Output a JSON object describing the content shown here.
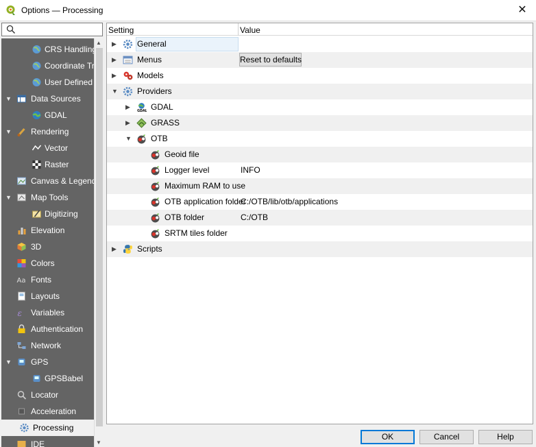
{
  "window": {
    "title": "Options — Processing",
    "close_symbol": "✕"
  },
  "search": {
    "placeholder": ""
  },
  "sidebar": {
    "items": [
      {
        "label": "CRS Handling",
        "icon": "globe-icon",
        "level": 1
      },
      {
        "label": "Coordinate Transforms",
        "icon": "globe-icon",
        "level": 1
      },
      {
        "label": "User Defined CRS",
        "icon": "globe-icon",
        "level": 1
      },
      {
        "label": "Data Sources",
        "icon": "table-icon",
        "level": 0,
        "expanded": true
      },
      {
        "label": "GDAL",
        "icon": "gdal-globe-icon",
        "level": 1
      },
      {
        "label": "Rendering",
        "icon": "brush-icon",
        "level": 0,
        "expanded": true
      },
      {
        "label": "Vector",
        "icon": "vector-icon",
        "level": 1
      },
      {
        "label": "Raster",
        "icon": "raster-icon",
        "level": 1
      },
      {
        "label": "Canvas & Legend",
        "icon": "canvas-icon",
        "level": 0
      },
      {
        "label": "Map Tools",
        "icon": "map-tools-icon",
        "level": 0,
        "expanded": true
      },
      {
        "label": "Digitizing",
        "icon": "digitizing-icon",
        "level": 1
      },
      {
        "label": "Elevation",
        "icon": "elevation-icon",
        "level": 0
      },
      {
        "label": "3D",
        "icon": "cube-icon",
        "level": 0
      },
      {
        "label": "Colors",
        "icon": "colors-icon",
        "level": 0
      },
      {
        "label": "Fonts",
        "icon": "fonts-icon",
        "level": 0
      },
      {
        "label": "Layouts",
        "icon": "layouts-icon",
        "level": 0
      },
      {
        "label": "Variables",
        "icon": "variables-icon",
        "level": 0
      },
      {
        "label": "Authentication",
        "icon": "lock-icon",
        "level": 0
      },
      {
        "label": "Network",
        "icon": "network-icon",
        "level": 0
      },
      {
        "label": "GPS",
        "icon": "gps-icon",
        "level": 0,
        "expanded": true
      },
      {
        "label": "GPSBabel",
        "icon": "gps-icon",
        "level": 1
      },
      {
        "label": "Locator",
        "icon": "search-icon",
        "level": 0
      },
      {
        "label": "Acceleration",
        "icon": "chip-icon",
        "level": 0
      },
      {
        "label": "Processing",
        "icon": "gear-icon",
        "level": 0,
        "selected": true
      },
      {
        "label": "IDE",
        "icon": "ide-icon",
        "level": 0
      }
    ]
  },
  "tree": {
    "header": {
      "setting": "Setting",
      "value": "Value"
    },
    "rows": [
      {
        "label": "General",
        "icon": "gear-icon",
        "level": 0,
        "toggle": "collapsed",
        "selected": true
      },
      {
        "label": "Menus",
        "icon": "menus-icon",
        "level": 0,
        "toggle": "collapsed",
        "button": "Reset to defaults"
      },
      {
        "label": "Models",
        "icon": "models-icon",
        "level": 0,
        "toggle": "collapsed"
      },
      {
        "label": "Providers",
        "icon": "gear-icon",
        "level": 0,
        "toggle": "expanded"
      },
      {
        "label": "GDAL",
        "icon": "gdal-icon",
        "level": 1,
        "toggle": "collapsed"
      },
      {
        "label": "GRASS",
        "icon": "grass-icon",
        "level": 1,
        "toggle": "collapsed"
      },
      {
        "label": "OTB",
        "icon": "otb-icon",
        "level": 1,
        "toggle": "expanded"
      },
      {
        "label": "Geoid file",
        "icon": "otb-icon",
        "level": 2,
        "value": ""
      },
      {
        "label": "Logger level",
        "icon": "otb-icon",
        "level": 2,
        "value": "INFO"
      },
      {
        "label": "Maximum RAM to use",
        "icon": "otb-icon",
        "level": 2,
        "value": ""
      },
      {
        "label": "OTB application folder",
        "icon": "otb-icon",
        "level": 2,
        "value": "C:/OTB/lib/otb/applications"
      },
      {
        "label": "OTB folder",
        "icon": "otb-icon",
        "level": 2,
        "value": "C:/OTB"
      },
      {
        "label": "SRTM tiles folder",
        "icon": "otb-icon",
        "level": 2,
        "value": ""
      },
      {
        "label": "Scripts",
        "icon": "python-icon",
        "level": 0,
        "toggle": "collapsed"
      }
    ]
  },
  "buttons": {
    "ok": "OK",
    "cancel": "Cancel",
    "help": "Help"
  },
  "colors": {
    "sidebar_bg": "#646464",
    "accent": "#0078d7",
    "selection": "#eaf3fb"
  }
}
